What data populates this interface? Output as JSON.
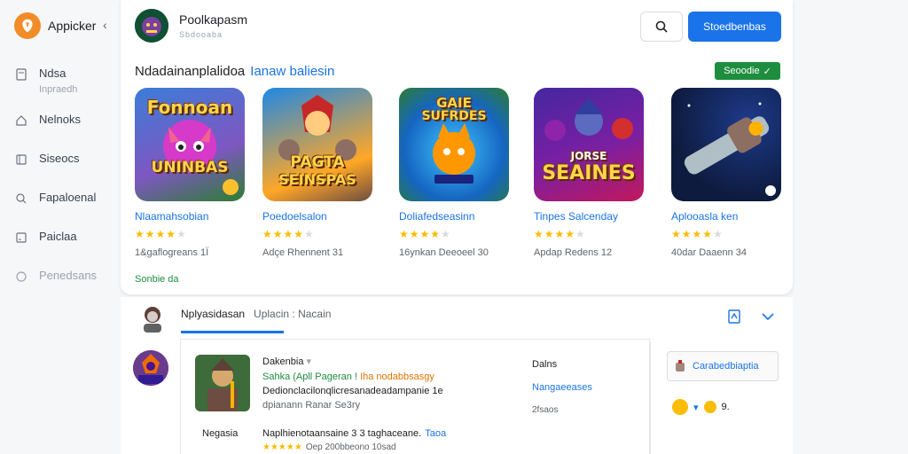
{
  "brand": {
    "name": "Appicker"
  },
  "sidebar": {
    "items": [
      {
        "label": "Ndsa",
        "sub": "Inpraedh",
        "icon": "page-icon"
      },
      {
        "label": "Nelnoks",
        "icon": "home-icon"
      },
      {
        "label": "Siseocs",
        "icon": "book-icon"
      },
      {
        "label": "Fapaloenal",
        "icon": "search-icon"
      },
      {
        "label": "Paiclaa",
        "icon": "note-icon"
      },
      {
        "label": "Penedsans",
        "icon": "circle-icon"
      }
    ]
  },
  "header": {
    "title": "Poolkapasm",
    "subtitle": "Sbdooaba",
    "primary_button": "Stoedbenbas"
  },
  "section": {
    "title": "Ndadainanplalidoa",
    "accent": "Ianaw baliesin",
    "status": "Seoodie",
    "see_all": "Sonbie da"
  },
  "games": [
    {
      "name": "Nlaamahsobian",
      "rating": 4,
      "meta": "1&gaflogreans 1Ï",
      "art": "Fonnoan",
      "art2": "UNINBAS",
      "bg1": "#3b7dd8",
      "bg2": "#c23ad6"
    },
    {
      "name": "Poedoelsalon",
      "rating": 4,
      "meta": "Adçe Rhennent 31",
      "art": "PAGTA",
      "art2": "SEINSPAS",
      "bg1": "#1e88e5",
      "bg2": "#f57c00"
    },
    {
      "name": "Doliafedseasinn",
      "rating": 4,
      "meta": "16ynkan Deeoeel 30",
      "art": "GAIE",
      "art2": "SUFRDES",
      "bg1": "#00b0ff",
      "bg2": "#2e7d32"
    },
    {
      "name": "Tinpes Salcenday",
      "rating": 4,
      "meta": "Apdap Redens 12",
      "art": "SEAINES",
      "art2": "JORSE",
      "bg1": "#512da8",
      "bg2": "#c2185b"
    },
    {
      "name": "Aplooasla ken",
      "rating": 4,
      "meta": "40dar Daaenn 34",
      "art": "",
      "art2": "",
      "bg1": "#0d1b3e",
      "bg2": "#ef6c00"
    }
  ],
  "lower": {
    "title": "Nplyasidasan",
    "meta": "Uplacin : Nacain",
    "detail": {
      "name": "Dakenbia",
      "line1a": "Sahka (Apll Pageran !",
      "line1b": "Iha nodabbsasgy",
      "line2": "Dedionclacilonqlicresanadeadampanie 1e",
      "line3": "dpianann Ranar Se3ry",
      "label": "Negasia",
      "line4": "Naplhienotaansaine 3 3 taghaceane.",
      "line4b": "Taoa",
      "stars": "★★★★★",
      "line5": "Oep 200bbeono 10sad",
      "right_head": "Dalns",
      "right_tag": "Nangaeeases",
      "right_date": "2fsaos"
    },
    "chip": "Carabedbiaptia",
    "reaction_count": "9."
  }
}
